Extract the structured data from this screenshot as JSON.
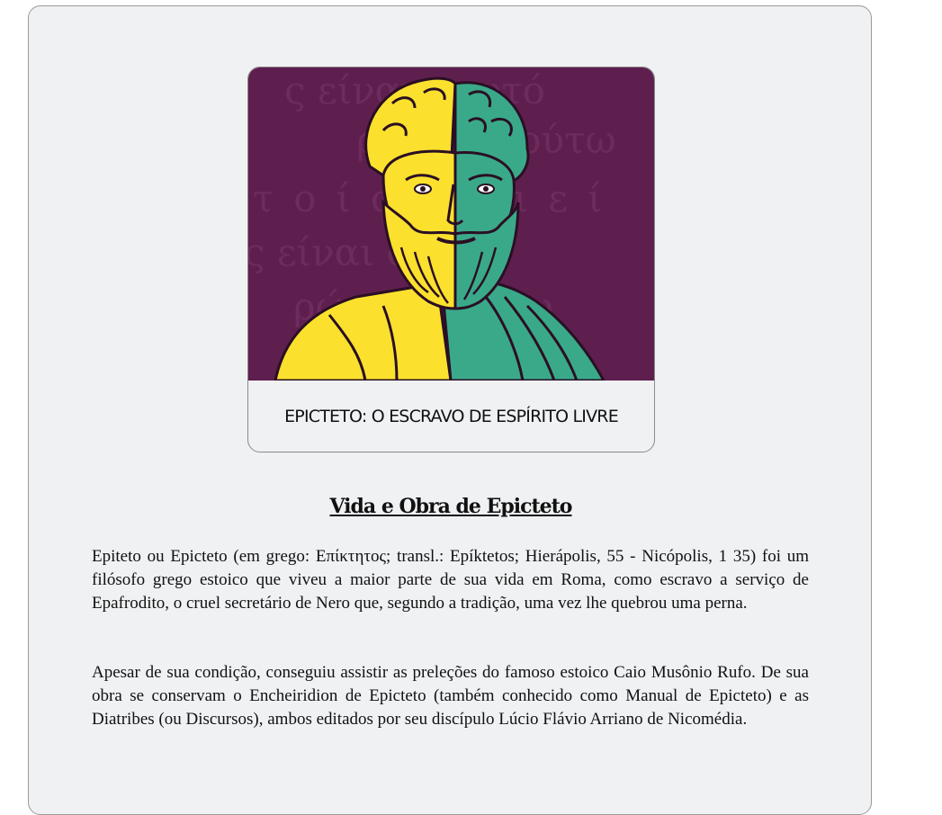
{
  "hero": {
    "caption": "EPICTETO: O ESCRAVO DE ESPÍRITO LIVRE",
    "image_alt": "Ilustração de Epicteto",
    "background_text_lines": [
      "ς είναι σαυτό",
      "ρώτον ∙ ούτω",
      "τοίς ∙ ιεί",
      "ς είναι σαυτό",
      "ρώτον ∙ ούτω"
    ]
  },
  "article": {
    "title": "Vida e Obra de Epicteto",
    "paragraphs": [
      "Epiteto ou Epicteto (em grego: Επίκτητος; transl.: Epíktetos; Hierápolis, 55 - Nicópolis, 1 35) foi um filósofo grego estoico que viveu a maior parte de sua vida em Roma, como escravo a serviço de Epafrodito, o cruel secretário de Nero que, segundo a tradição, uma vez lhe quebrou uma perna.",
      "Apesar de sua condição, conseguiu assistir as preleções do famoso estoico Caio Musônio Rufo. De sua obra se conservam o Encheiridion de Epicteto (também conhecido como Manual de Epicteto) e as Diatribes (ou Discursos), ambos editados por seu discípulo Lúcio Flávio Arriano de Nicomédia."
    ]
  },
  "colors": {
    "purple": "#5e1f4e",
    "yellow": "#fbe12d",
    "teal": "#3aa98a",
    "outline": "#2a0f24"
  }
}
